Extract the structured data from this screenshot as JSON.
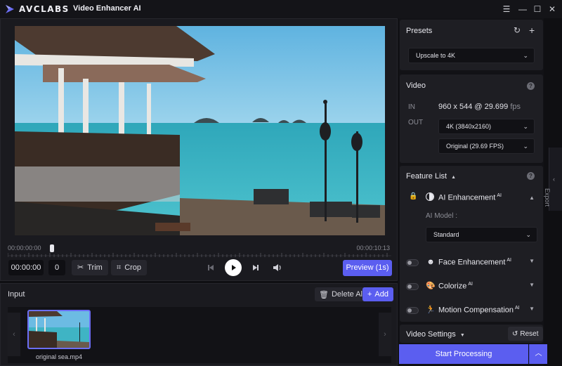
{
  "titlebar": {
    "brand": "AVCLABS",
    "app_title": "Video Enhancer AI",
    "menu_icon": "hamburger-icon",
    "minimize_icon": "minimize-icon",
    "maximize_icon": "maximize-icon",
    "close_icon": "close-icon"
  },
  "player": {
    "timecode_start": "00:00:00:00",
    "timecode_end": "00:00:10:13",
    "current_time": "00:00:00",
    "frame": "0",
    "trim_label": "Trim",
    "crop_label": "Crop",
    "preview_label": "Preview (1s)",
    "progress": 0.11
  },
  "input": {
    "title": "Input",
    "delete_label": "Delete All",
    "add_label": "Add",
    "files": [
      {
        "name": "original sea.mp4"
      }
    ]
  },
  "presets": {
    "title": "Presets",
    "selected": "Upscale to 4K"
  },
  "video": {
    "title": "Video",
    "in_label": "IN",
    "in_value": "960 x 544 @ 29.699",
    "in_unit": "fps",
    "out_label": "OUT",
    "resolution": "4K (3840x2160)",
    "framerate": "Original (29.69 FPS)"
  },
  "features": {
    "title": "Feature List",
    "ai_enhancement": {
      "name": "AI Enhancement",
      "sup": "AI",
      "model_label": "AI Model :",
      "model_value": "Standard"
    },
    "items": [
      {
        "name": "Face Enhancement",
        "sup": "AI"
      },
      {
        "name": "Colorize",
        "sup": "AI"
      },
      {
        "name": "Motion Compensation",
        "sup": "AI"
      }
    ]
  },
  "video_settings": {
    "title": "Video Settings",
    "reset_label": "Reset"
  },
  "actions": {
    "start_label": "Start Processing"
  },
  "export_tab": {
    "label": "Export"
  },
  "colors": {
    "accent": "#5b5ef0",
    "background": "#0f0f12",
    "panel": "#1e1e23"
  }
}
